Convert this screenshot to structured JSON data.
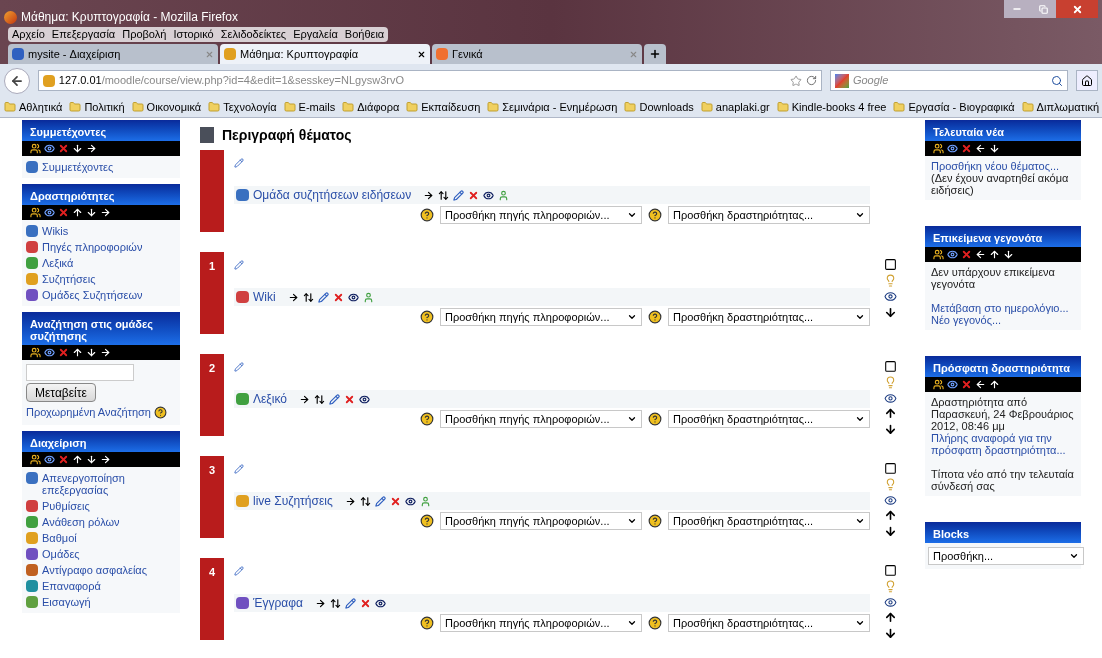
{
  "window": {
    "title": "Μάθημα: Κρυπτογραφία - Mozilla Firefox"
  },
  "menu": [
    "Αρχείο",
    "Επεξεργασία",
    "Προβολή",
    "Ιστορικό",
    "Σελιδοδείκτες",
    "Εργαλεία",
    "Βοήθεια"
  ],
  "tabs": [
    {
      "label": "mysite - Διαχείριση",
      "selected": false
    },
    {
      "label": "Μάθημα: Κρυπτογραφία",
      "selected": true
    },
    {
      "label": "Γενικά",
      "selected": false
    }
  ],
  "address": {
    "host": "127.0.01",
    "path": "/moodle/course/view.php?id=4&edit=1&sesskey=NLgysw3rvO"
  },
  "search": {
    "placeholder": "Google"
  },
  "bookmarks": [
    "Αθλητικά",
    "Πολιτική",
    "Οικονομικά",
    "Τεχνολογία",
    "E-mails",
    "Διάφορα",
    "Εκπαίδευση",
    "Σεμινάρια - Ενημέρωση",
    "Downloads",
    "anaplaki.gr",
    "Kindle-books 4 free",
    "Εργασία - Βιογραφικά",
    "Διπλωματική"
  ],
  "left_blocks": [
    {
      "title": "Συμμετέχοντες",
      "kind": "links",
      "can_move_up": false,
      "can_move_down": true,
      "items": [
        "Συμμετέχοντες"
      ]
    },
    {
      "title": "Δραστηριότητες",
      "kind": "links",
      "can_move_up": true,
      "can_move_down": true,
      "items": [
        "Wikis",
        "Πηγές πληροφοριών",
        "Λεξικά",
        "Συζητήσεις",
        "Ομάδες Συζητήσεων"
      ]
    },
    {
      "title": "Αναζήτηση στις ομάδες συζήτησης",
      "kind": "search",
      "can_move_up": true,
      "can_move_down": true,
      "button": "Μεταβείτε",
      "link": "Προχωρημένη Αναζήτηση"
    },
    {
      "title": "Διαχείριση",
      "kind": "links",
      "can_move_up": true,
      "can_move_down": true,
      "items": [
        "Απενεργοποίηση επεξεργασίας",
        "Ρυθμίσεις",
        "Ανάθεση ρόλων",
        "Βαθμοί",
        "Ομάδες",
        "Αντίγραφο ασφαλείας",
        "Επαναφορά",
        "Εισαγωγή"
      ]
    }
  ],
  "main": {
    "heading": "Περιγραφή θέματος",
    "sections": [
      {
        "activity": "Ομάδα συζητήσεων ειδήσεων",
        "groupmode": true,
        "has_controls": false,
        "resource_select": "Προσθήκη πηγής πληροφοριών...",
        "activity_select": "Προσθήκη δραστηριότητας..."
      },
      {
        "number": "1",
        "activity": "Wiki",
        "groupmode": true,
        "has_controls": true,
        "can_move_up": false,
        "can_move_down": true,
        "resource_select": "Προσθήκη πηγής πληροφοριών...",
        "activity_select": "Προσθήκη δραστηριότητας..."
      },
      {
        "number": "2",
        "activity": "Λεξικό",
        "groupmode": false,
        "has_controls": true,
        "can_move_up": true,
        "can_move_down": true,
        "resource_select": "Προσθήκη πηγής πληροφοριών...",
        "activity_select": "Προσθήκη δραστηριότητας..."
      },
      {
        "number": "3",
        "activity": "live Συζητήσεις",
        "groupmode": true,
        "has_controls": true,
        "can_move_up": true,
        "can_move_down": true,
        "resource_select": "Προσθήκη πηγής πληροφοριών...",
        "activity_select": "Προσθήκη δραστηριότητας..."
      },
      {
        "number": "4",
        "activity": "Έγγραφα",
        "groupmode": false,
        "has_controls": true,
        "can_move_up": true,
        "can_move_down": true,
        "resource_select": "Προσθήκη πηγής πληροφοριών...",
        "activity_select": "Προσθήκη δραστηριότητας..."
      }
    ]
  },
  "right_blocks": [
    {
      "title": "Τελευταία νέα",
      "toolbar": true,
      "can_move_up": false,
      "can_move_down": true,
      "lines": [
        {
          "kind": "link",
          "text": "Προσθήκη νέου θέματος..."
        },
        {
          "kind": "text",
          "text": "(Δεν έχουν αναρτηθεί ακόμα ειδήσεις)"
        }
      ]
    },
    {
      "title": "Επικείμενα γεγονότα",
      "toolbar": true,
      "can_move_up": true,
      "can_move_down": true,
      "lines": [
        {
          "kind": "text",
          "text": "Δεν υπάρχουν επικείμενα γεγονότα"
        },
        {
          "kind": "gap"
        },
        {
          "kind": "link",
          "text": "Μετάβαση στο ημερολόγιο..."
        },
        {
          "kind": "link",
          "text": "Νέο γεγονός..."
        }
      ]
    },
    {
      "title": "Πρόσφατη δραστηριότητα",
      "toolbar": true,
      "can_move_up": true,
      "can_move_down": false,
      "lines": [
        {
          "kind": "text",
          "text": "Δραστηριότητα από Παρασκευή, 24 Φεβρουάριος 2012, 08:46 μμ"
        },
        {
          "kind": "link",
          "text": "Πλήρης αναφορά για την πρόσφατη δραστηριότητα..."
        },
        {
          "kind": "gap"
        },
        {
          "kind": "text",
          "text": "Τίποτα νέο από την τελευταία σύνδεσή σας"
        }
      ]
    },
    {
      "title": "Blocks",
      "toolbar": false,
      "lines": [
        {
          "kind": "select",
          "text": "Προσθήκη..."
        }
      ]
    }
  ]
}
